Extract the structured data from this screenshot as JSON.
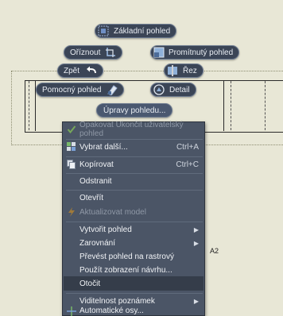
{
  "marking_menu": {
    "base_view": "Základní pohled",
    "crop": "Oříznout",
    "projected_view": "Promítnutý pohled",
    "back": "Zpět",
    "section": "Řez",
    "auxiliary_view": "Pomocný pohled",
    "detail": "Detail",
    "edit_view": "Úpravy pohledu..."
  },
  "context_menu": {
    "items": [
      {
        "label": "Opakovat Ukončit uživatelský pohled",
        "shortcut": "",
        "disabled": true
      },
      {
        "label": "Vybrat další...",
        "shortcut": "Ctrl+A"
      },
      {
        "label": "Kopírovat",
        "shortcut": "Ctrl+C"
      },
      {
        "label": "Odstranit",
        "shortcut": ""
      },
      {
        "label": "Otevřít",
        "shortcut": ""
      },
      {
        "label": "Aktualizovat model",
        "shortcut": "",
        "disabled": true
      },
      {
        "label": "Vytvořit pohled",
        "submenu": true
      },
      {
        "label": "Zarovnání",
        "submenu": true
      },
      {
        "label": "Převést pohled na rastrový"
      },
      {
        "label": "Použít zobrazení návrhu..."
      },
      {
        "label": "Otočit",
        "highlighted": true
      },
      {
        "label": "Viditelnost poznámek",
        "submenu": true
      },
      {
        "label": "Automatické osy..."
      }
    ]
  },
  "sheet": {
    "zone_label": "A2"
  },
  "colors": {
    "background": "#e8e7d6",
    "menu_bg": "#4b5566",
    "pill_bg": "#3b4556",
    "highlight": "#353d4a"
  }
}
